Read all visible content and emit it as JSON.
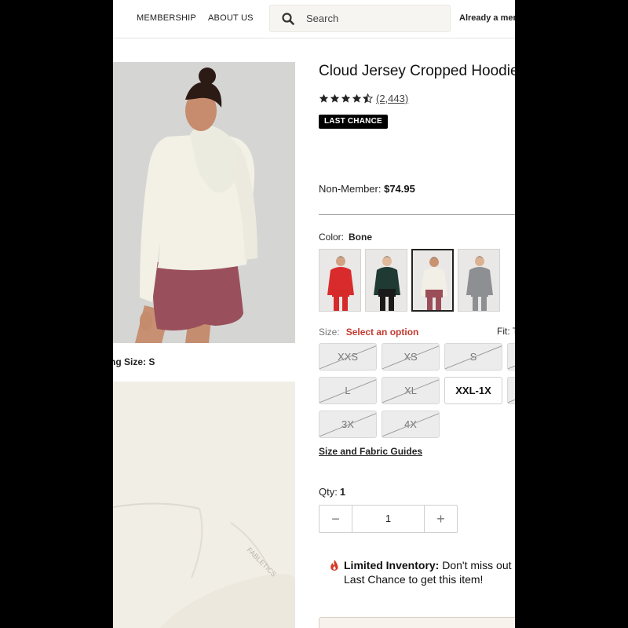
{
  "header": {
    "nav": [
      "MEMBERSHIP",
      "ABOUT US"
    ],
    "search_placeholder": "Search",
    "member_link": "Already a mem"
  },
  "gallery": {
    "fit_note": "ng Size: S",
    "watermark": "FABLETICS"
  },
  "product": {
    "title": "Cloud Jersey Cropped Hoodie",
    "rating": 4.5,
    "reviews": "(2,443)",
    "badge": "LAST CHANCE",
    "price_label": "Non-Member:",
    "price": "$74.95"
  },
  "color": {
    "label": "Color:",
    "selected": "Bone",
    "swatches": [
      {
        "name": "Red",
        "top": "#d92b2b",
        "bottom": "#d62a2a",
        "skin": "#d2a284"
      },
      {
        "name": "Green",
        "top": "#1f3a33",
        "bottom": "#1a1a1a",
        "skin": "#e1b99b"
      },
      {
        "name": "Bone",
        "top": "#f2efe6",
        "bottom": "#9b4d58",
        "skin": "#c99271"
      },
      {
        "name": "Grey",
        "top": "#8d8f93",
        "bottom": "#8d8f93",
        "skin": "#dcb191"
      }
    ]
  },
  "sizes": {
    "label": "Size:",
    "prompt": "Select an option",
    "fit_label": "Fit: T",
    "options": [
      {
        "label": "XXS",
        "available": false
      },
      {
        "label": "XS",
        "available": false
      },
      {
        "label": "S",
        "available": false
      },
      {
        "label": "L",
        "available": false
      },
      {
        "label": "XL",
        "available": false
      },
      {
        "label": "XXL-1X",
        "available": true
      },
      {
        "label": "3X",
        "available": false
      },
      {
        "label": "4X",
        "available": false
      }
    ],
    "guides_link": "Size and Fabric Guides"
  },
  "quantity": {
    "label": "Qty:",
    "value": "1",
    "minus": "−",
    "plus": "+",
    "field_value": "1"
  },
  "inventory": {
    "title": "Limited Inventory:",
    "line1": "Don't miss out o",
    "line2": "Last Chance to get this item!"
  },
  "colors": {
    "accent_red": "#c2392e",
    "badge_bg": "#000000"
  }
}
